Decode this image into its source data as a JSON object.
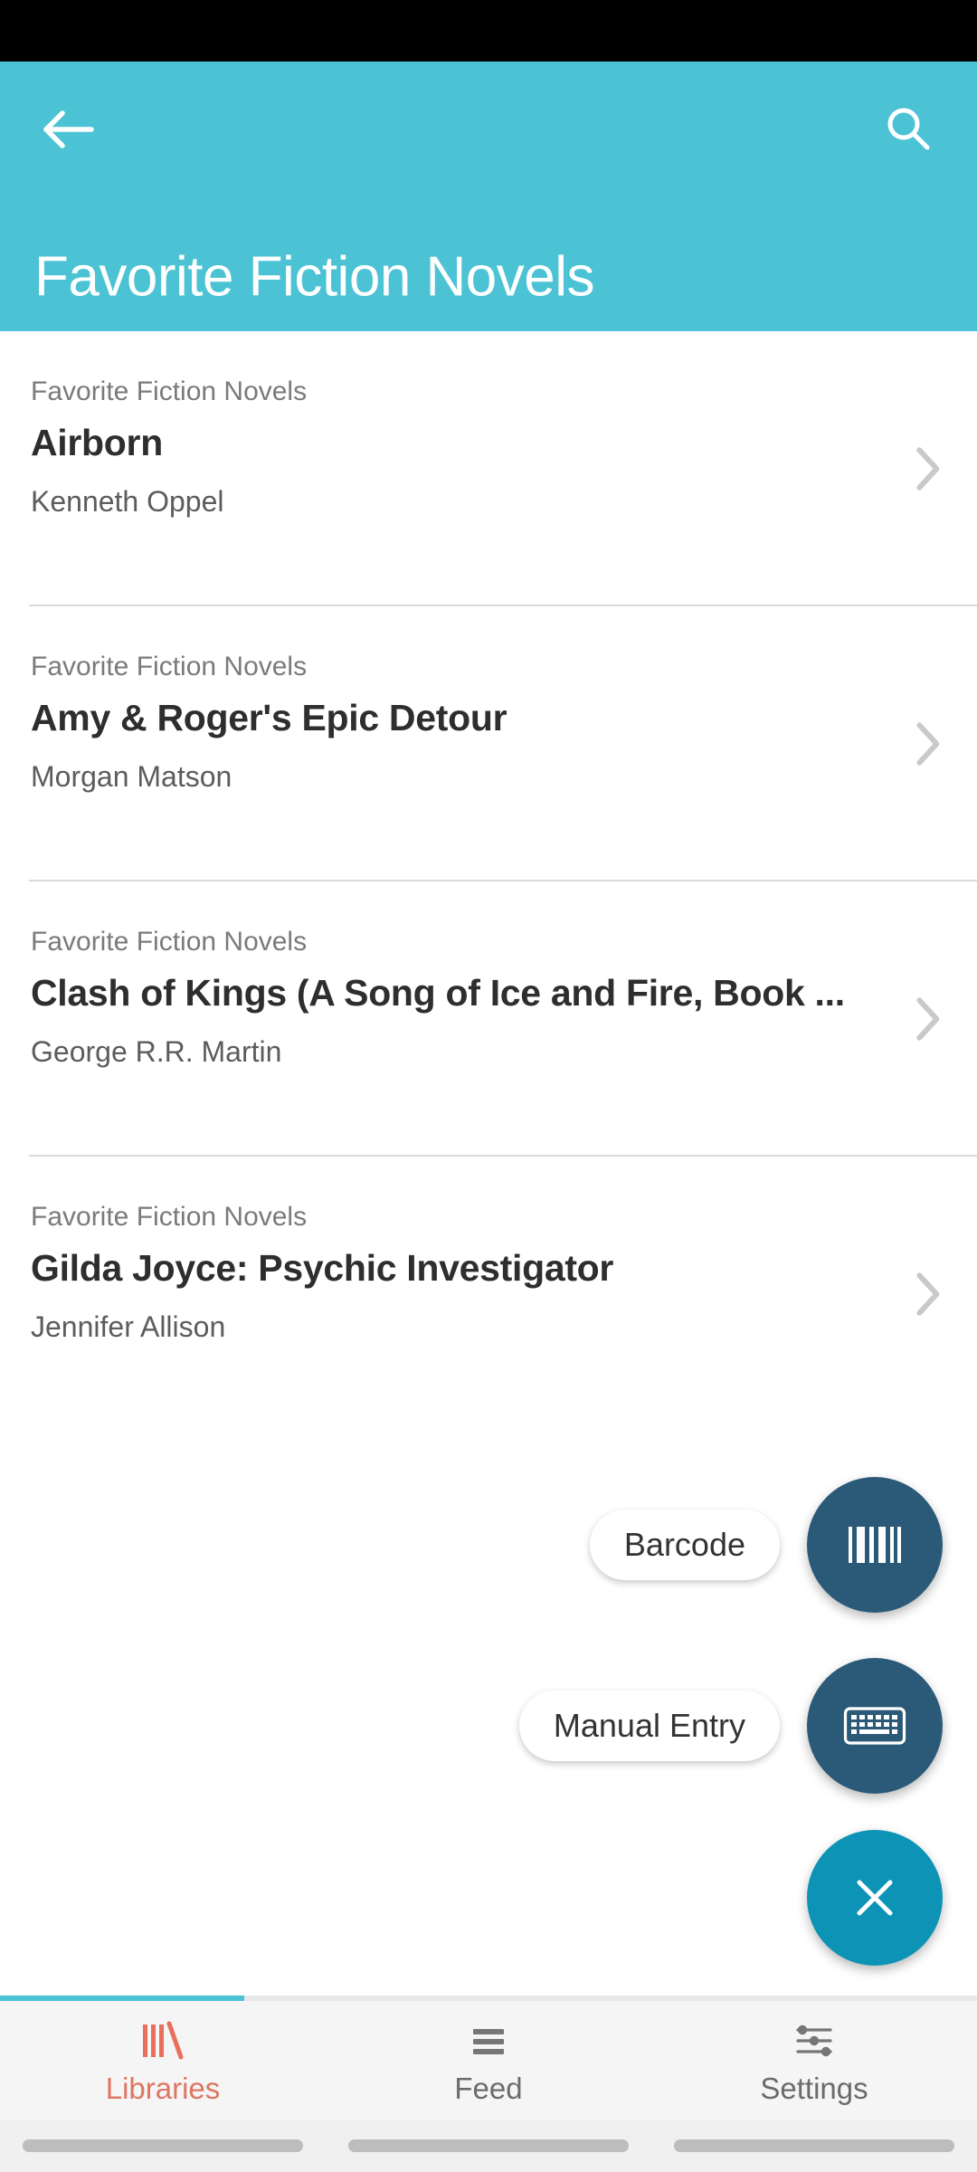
{
  "appbar": {
    "title": "Favorite Fiction Novels",
    "back_icon": "arrow-left-icon",
    "search_icon": "search-icon",
    "background_color": "#4bc3d5"
  },
  "list": {
    "items": [
      {
        "category": "Favorite Fiction Novels",
        "title": "Airborn",
        "author": "Kenneth Oppel",
        "chevron_icon": "chevron-right-icon"
      },
      {
        "category": "Favorite Fiction Novels",
        "title": "Amy & Roger's Epic Detour",
        "author": "Morgan Matson",
        "chevron_icon": "chevron-right-icon"
      },
      {
        "category": "Favorite Fiction Novels",
        "title": "Clash of Kings (A Song of Ice and Fire, Book ...",
        "author": "George R.R. Martin",
        "chevron_icon": "chevron-right-icon"
      },
      {
        "category": "Favorite Fiction Novels",
        "title": "Gilda Joyce: Psychic Investigator",
        "author": "Jennifer Allison",
        "chevron_icon": "chevron-right-icon"
      }
    ]
  },
  "fab_menu": {
    "expanded": true,
    "actions": [
      {
        "label": "Barcode",
        "icon": "barcode-icon",
        "color": "#2b5a79"
      },
      {
        "label": "Manual Entry",
        "icon": "keyboard-icon",
        "color": "#2b5a79"
      }
    ],
    "close": {
      "icon": "close-icon",
      "color": "#0d93b5"
    }
  },
  "bottom_nav": {
    "indicator_color": "#4bc3d5",
    "active_color": "#dd7662",
    "items": [
      {
        "label": "Libraries",
        "icon": "books-icon",
        "active": true
      },
      {
        "label": "Feed",
        "icon": "list-lines-icon",
        "active": false
      },
      {
        "label": "Settings",
        "icon": "sliders-icon",
        "active": false
      }
    ]
  }
}
